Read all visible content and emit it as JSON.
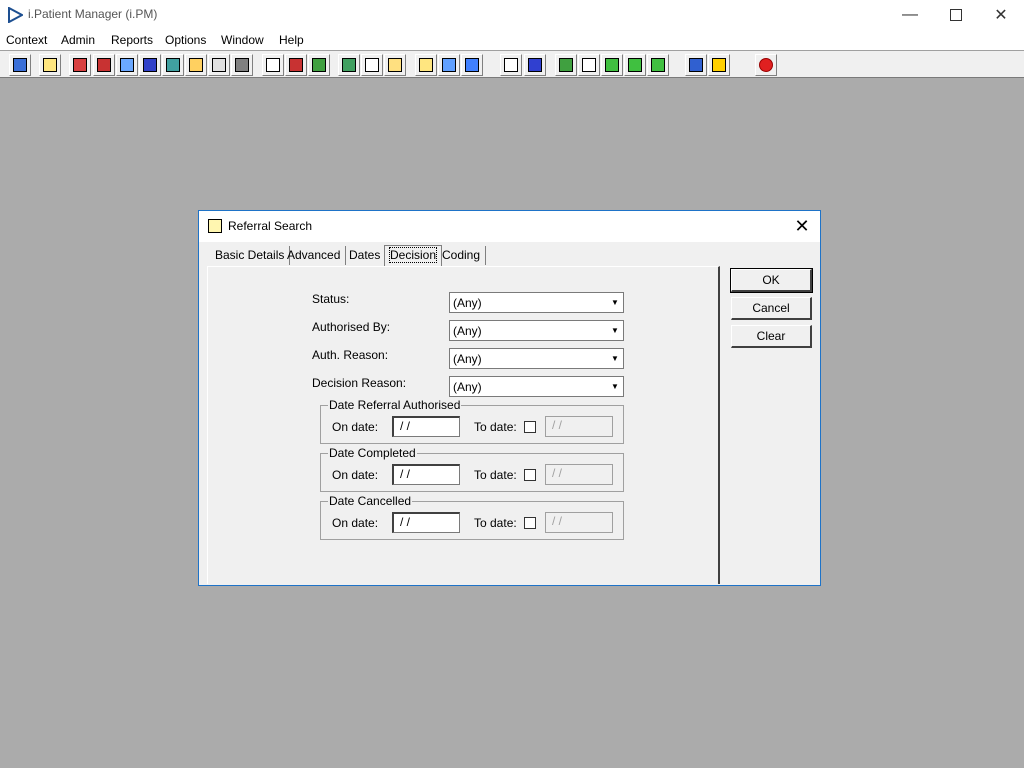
{
  "window": {
    "title": "i.Patient Manager (i.PM)"
  },
  "menu": [
    "Context",
    "Admin",
    "Reports",
    "Options",
    "Window",
    "Help"
  ],
  "toolbar_icons": [
    "patient-icon",
    "printer-icon",
    "book-icon",
    "house-icon",
    "search-icon",
    "letter-m-icon",
    "doctor-icon",
    "notes-icon",
    "referral-icon",
    "camera-icon",
    "magnify-icon",
    "clock-icon",
    "monitor-icon",
    "document-icon",
    "document-edit-icon",
    "gauge-icon",
    "list-icon",
    "bed-icon",
    "ambulance-icon",
    "page-icon",
    "bar-chart-icon",
    "globe-icon",
    "check-icon",
    "check-list-icon",
    "arrow-in-icon",
    "arrow-out-icon",
    "transfer-icon",
    "warning-icon",
    "exit-icon"
  ],
  "dialog": {
    "title": "Referral Search",
    "tabs": [
      "Basic Details",
      "Advanced",
      "Dates",
      "Decision",
      "Coding"
    ],
    "active_tab": "Decision",
    "fields": [
      {
        "label": "Status:",
        "value": "(Any)"
      },
      {
        "label": "Authorised By:",
        "value": "(Any)"
      },
      {
        "label": "Auth. Reason:",
        "value": "(Any)"
      },
      {
        "label": "Decision Reason:",
        "value": "(Any)"
      }
    ],
    "date_groups": [
      {
        "title": "Date Referral Authorised",
        "on_label": "On date:",
        "on_value": "/ /",
        "to_label": "To date:",
        "to_checked": false,
        "to_value": "/ /"
      },
      {
        "title": "Date Completed",
        "on_label": "On date:",
        "on_value": "/ /",
        "to_label": "To date:",
        "to_checked": false,
        "to_value": "/ /"
      },
      {
        "title": "Date Cancelled",
        "on_label": "On date:",
        "on_value": "/ /",
        "to_label": "To date:",
        "to_checked": false,
        "to_value": "/ /"
      }
    ],
    "buttons": {
      "ok": "OK",
      "cancel": "Cancel",
      "clear": "Clear"
    }
  }
}
